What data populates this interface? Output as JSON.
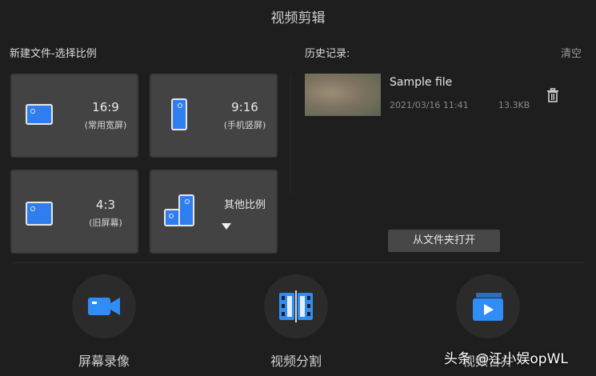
{
  "window": {
    "title": "视频剪辑"
  },
  "new_file": {
    "label": "新建文件-选择比例",
    "cards": [
      {
        "ratio": "16:9",
        "desc": "(常用宽屏)",
        "icon": "landscape-screen-icon"
      },
      {
        "ratio": "9:16",
        "desc": "(手机竖屏)",
        "icon": "portrait-phone-icon"
      },
      {
        "ratio": "4:3",
        "desc": "(旧屏幕)",
        "icon": "landscape-screen-icon"
      },
      {
        "ratio": "其他比例",
        "desc": "",
        "icon": "mixed-ratio-icon"
      }
    ]
  },
  "history": {
    "label": "历史记录:",
    "clear_label": "清空",
    "items": [
      {
        "name": "Sample file",
        "date": "2021/03/16 11:41",
        "size": "13.3KB"
      }
    ],
    "open_folder_label": "从文件夹打开"
  },
  "tools": [
    {
      "label": "屏幕录像",
      "icon": "camera-record-icon"
    },
    {
      "label": "视频分割",
      "icon": "film-split-icon"
    },
    {
      "label": "视频合并",
      "icon": "video-play-icon"
    }
  ],
  "watermark": "头条 @江小娱opWL",
  "colors": {
    "accent": "#2f7ef0",
    "background": "#1e1e1e",
    "card": "#434343"
  }
}
